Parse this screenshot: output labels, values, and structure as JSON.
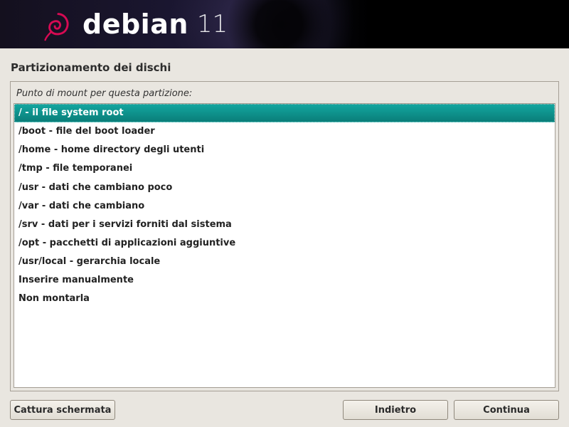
{
  "brand": "debian",
  "version": "11",
  "page_title": "Partizionamento dei dischi",
  "panel_label": "Punto di mount per questa partizione:",
  "options": [
    "/ - il file system root",
    "/boot - file del boot loader",
    "/home - home directory degli utenti",
    "/tmp - file temporanei",
    "/usr - dati che cambiano poco",
    "/var - dati che cambiano",
    "/srv - dati per i servizi forniti dal sistema",
    "/opt - pacchetti di applicazioni aggiuntive",
    "/usr/local - gerarchia locale",
    "Inserire manualmente",
    "Non montarla"
  ],
  "selected_index": 0,
  "buttons": {
    "screenshot": "Cattura schermata",
    "back": "Indietro",
    "continue": "Continua"
  }
}
